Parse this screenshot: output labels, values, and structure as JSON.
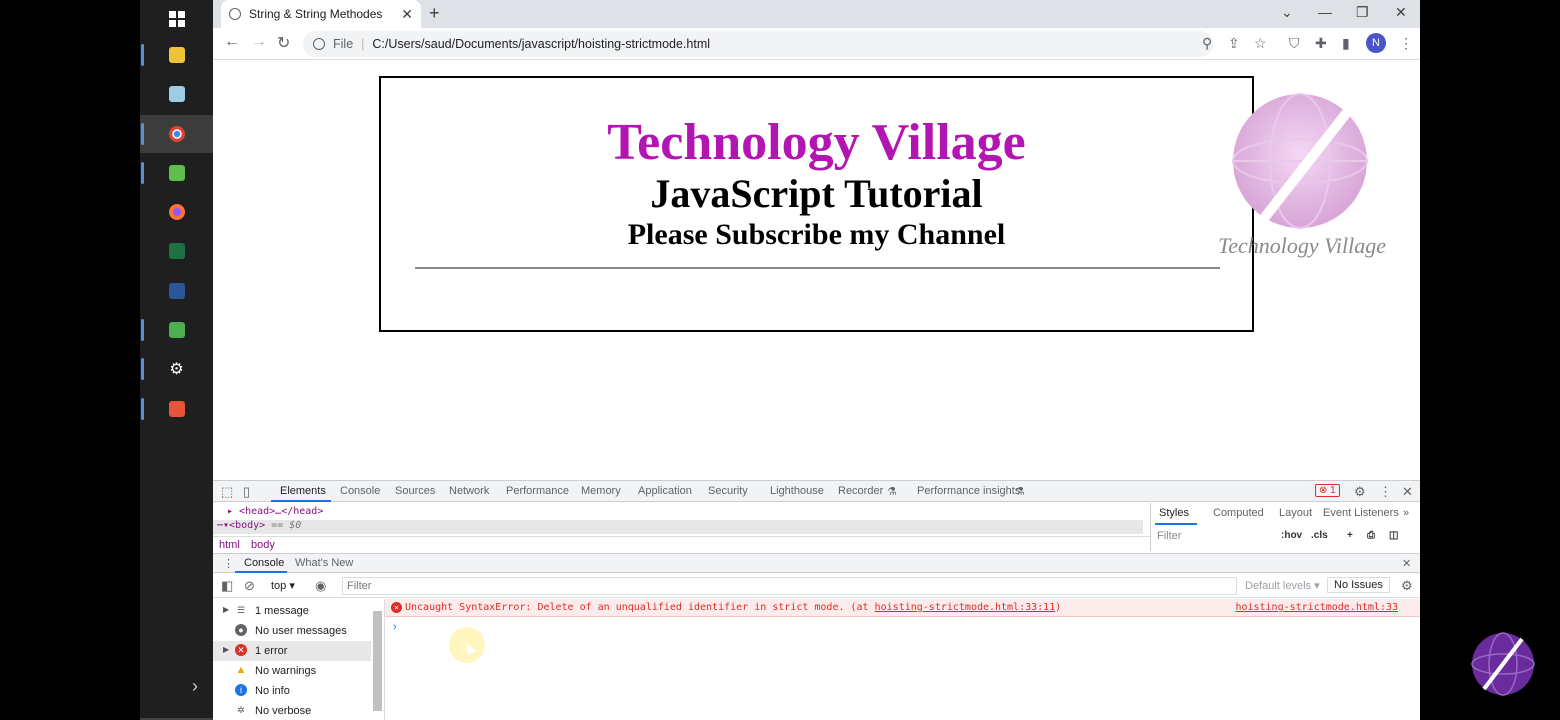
{
  "taskbar": {
    "items": [
      {
        "name": "windows-start-icon",
        "color": "#ffffff"
      },
      {
        "name": "file-explorer-icon",
        "color": "#f0c23b"
      },
      {
        "name": "notepad-icon",
        "color": "#9ecbe8"
      },
      {
        "name": "chrome-icon",
        "color": "#db4437"
      },
      {
        "name": "paint-icon",
        "color": "#5fbf4a"
      },
      {
        "name": "firefox-icon",
        "color": "#ff7139"
      },
      {
        "name": "excel-icon",
        "color": "#1e7145"
      },
      {
        "name": "word-icon",
        "color": "#2b579a"
      },
      {
        "name": "camtasia-icon",
        "color": "#4caf50"
      },
      {
        "name": "settings-gear-icon",
        "color": "#ffffff"
      },
      {
        "name": "camtasia-recorder-icon",
        "color": "#e8533a"
      }
    ],
    "chevron": "›"
  },
  "browser": {
    "tab_title": "String & String Methodes",
    "new_tab": "+",
    "address_scheme": "File",
    "address_url": "C:/Users/saud/Documents/javascript/hoisting-strictmode.html",
    "profile_initial": "N"
  },
  "page": {
    "title": "Technology Village",
    "subtitle": "JavaScript Tutorial",
    "subtitle2": "Please Subscribe my Channel",
    "logo_text": "Technology Village",
    "title_color": "#b315b3"
  },
  "devtools": {
    "tabs": [
      "Elements",
      "Console",
      "Sources",
      "Network",
      "Performance",
      "Memory",
      "Application",
      "Security",
      "Lighthouse",
      "Recorder",
      "Performance insights"
    ],
    "error_count": "1",
    "elements": {
      "line1": "<head>…</head>",
      "line2_tag": "<body>",
      "line2_eq": "== $0",
      "breadcrumb": [
        "html",
        "body"
      ]
    },
    "styles_tabs": [
      "Styles",
      "Computed",
      "Layout",
      "Event Listeners"
    ],
    "styles_filter_placeholder": "Filter",
    "styles_tools": [
      ":hov",
      ".cls"
    ],
    "drawer_tabs": [
      "Console",
      "What's New"
    ],
    "console_context": "top ▾",
    "filter_placeholder": "Filter",
    "default_levels": "Default levels ▾",
    "no_issues": "No Issues",
    "sidebar": [
      {
        "label": "1 message",
        "icon": "list-icon",
        "caret": true
      },
      {
        "label": "No user messages",
        "icon": "user-icon",
        "caret": false
      },
      {
        "label": "1 error",
        "icon": "error-icon",
        "caret": true
      },
      {
        "label": "No warnings",
        "icon": "warning-icon",
        "caret": false
      },
      {
        "label": "No info",
        "icon": "info-icon",
        "caret": false
      },
      {
        "label": "No verbose",
        "icon": "bug-icon",
        "caret": false
      }
    ],
    "error": {
      "message": "Uncaught SyntaxError: Delete of an unqualified identifier in strict mode. (at ",
      "link": "hoisting-strictmode.html:33:11",
      "suffix": ")",
      "source": "hoisting-strictmode.html:33"
    },
    "prompt": "›"
  }
}
